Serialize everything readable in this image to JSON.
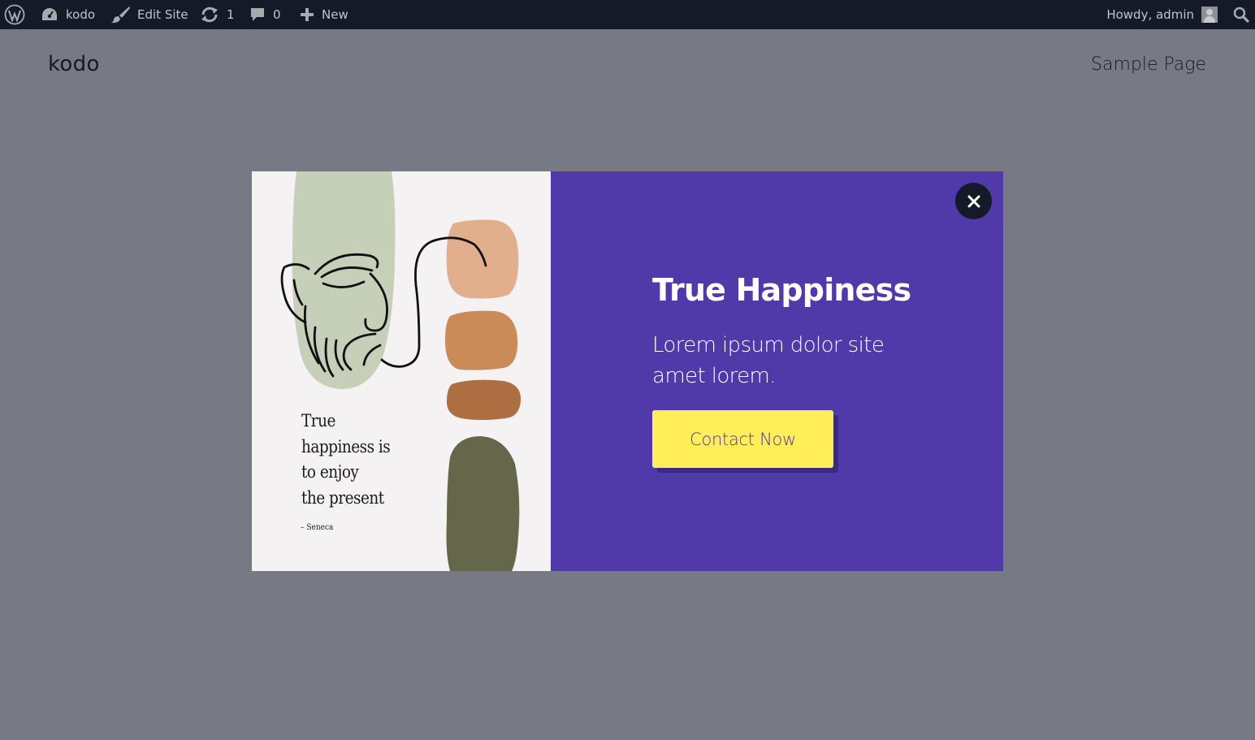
{
  "adminbar": {
    "site_name": "kodo",
    "edit_site": "Edit Site",
    "updates_count": "1",
    "comments_count": "0",
    "new_label": "New",
    "greeting": "Howdy, admin"
  },
  "site": {
    "title": "kodo",
    "nav": [
      "Sample Page"
    ]
  },
  "popup": {
    "art_quote_lines": [
      "True",
      "happiness is",
      "to enjoy",
      "the present"
    ],
    "art_author": "– Seneca",
    "title": "True Happiness",
    "text": "Lorem ipsum dolor site amet lorem.",
    "cta_label": "Contact Now",
    "close_icon": "close-icon"
  },
  "colors": {
    "overlay": "#777a84",
    "adminbar_bg": "#151a28",
    "popup_bg": "#5039a8",
    "cta_bg": "#ffee58",
    "art_bg": "#f4f2f2"
  }
}
